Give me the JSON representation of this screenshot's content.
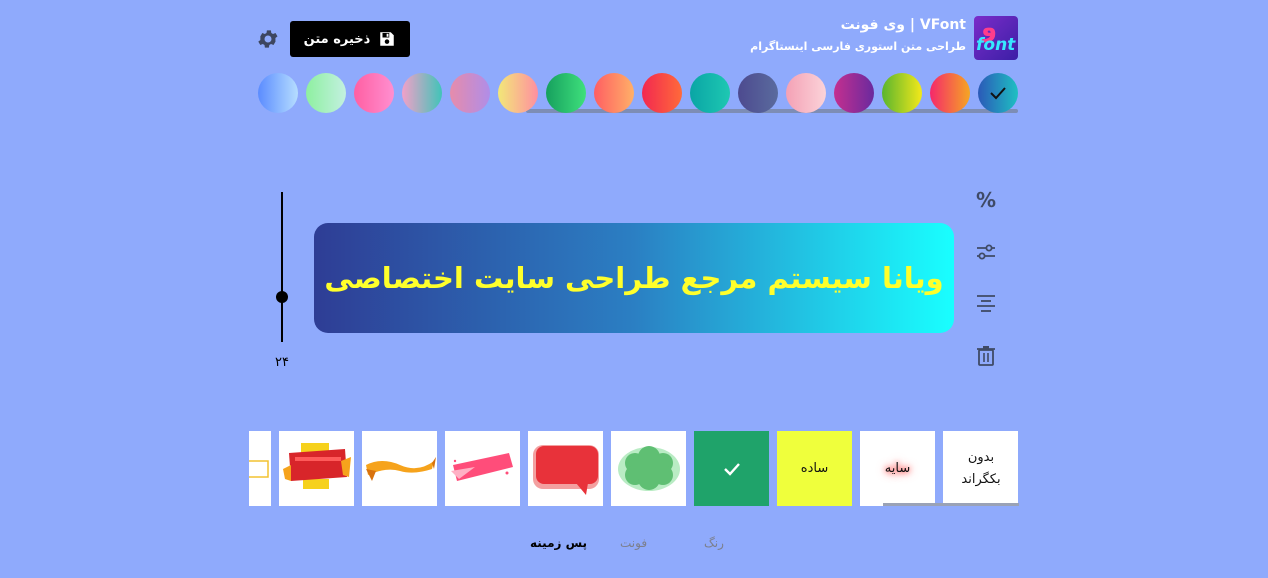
{
  "header": {
    "app_title": "وی فونت | VFont",
    "app_subtitle": "طراحی متن استوری فارسی اینستاگرام",
    "save_label": "ذخیره متن",
    "logo_text_top": "وی",
    "logo_text_bottom": "Font"
  },
  "colors": {
    "page_background": "#8faafc",
    "preview_text": "#ffff2b",
    "swatches": [
      {
        "name": "blue-teal",
        "from": "#2b59b8",
        "to": "#1ec0c2",
        "selected": true
      },
      {
        "name": "red-orange",
        "from": "#f5286b",
        "to": "#f5a623",
        "selected": false
      },
      {
        "name": "green-yellow",
        "from": "#5ab52e",
        "to": "#f3e81a",
        "selected": false
      },
      {
        "name": "magenta-purple",
        "from": "#c42f8f",
        "to": "#6a2a9e",
        "selected": false
      },
      {
        "name": "pink-light",
        "from": "#f4a1b5",
        "to": "#fbd3d9",
        "selected": false
      },
      {
        "name": "indigo-grey",
        "from": "#4d4a8f",
        "to": "#5a6b9e",
        "selected": false
      },
      {
        "name": "teal",
        "from": "#0aa5a5",
        "to": "#1ec8b2",
        "selected": false
      },
      {
        "name": "red-coral",
        "from": "#f22850",
        "to": "#ff6a3a",
        "selected": false
      },
      {
        "name": "coral-peach",
        "from": "#ff5e62",
        "to": "#ffb068",
        "selected": false
      },
      {
        "name": "green-emerald",
        "from": "#16a05e",
        "to": "#3fe07c",
        "selected": false
      },
      {
        "name": "yellow-pink",
        "from": "#f2e878",
        "to": "#ff8fa0",
        "selected": false
      },
      {
        "name": "pink-purple",
        "from": "#e68cab",
        "to": "#b08de8",
        "selected": false
      },
      {
        "name": "pink-teal",
        "from": "#f2a0c8",
        "to": "#40c4b8",
        "selected": false
      },
      {
        "name": "hot-pink",
        "from": "#ff5fa2",
        "to": "#ff8fd0",
        "selected": false
      },
      {
        "name": "mint",
        "from": "#8ef0a0",
        "to": "#c3f0e0",
        "selected": false
      },
      {
        "name": "blue-light",
        "from": "#5b8cff",
        "to": "#b6ddff",
        "selected": false
      }
    ]
  },
  "editor": {
    "preview_text": "ویانا سیستم مرجع طراحی سایت اختصاصی",
    "font_size_label": "۲۴",
    "font_size_value": 24,
    "tools": {
      "percent_label": "%",
      "adjust_icon": "sliders-icon",
      "align_icon": "align-center-icon",
      "delete_icon": "trash-icon"
    }
  },
  "backgrounds": {
    "none_label": "بدون بکگراند",
    "shadow_label": "سایه",
    "plain_label": "ساده",
    "items": [
      "none",
      "shadow",
      "plain",
      "selected-green",
      "cloud-green",
      "speech-red",
      "brush-pink",
      "ribbon-orange",
      "banner-red-yellow",
      "frame-yellow"
    ]
  },
  "tabs": {
    "background": "پس زمینه",
    "font": "فونت",
    "color": "رنگ",
    "active": "background"
  }
}
